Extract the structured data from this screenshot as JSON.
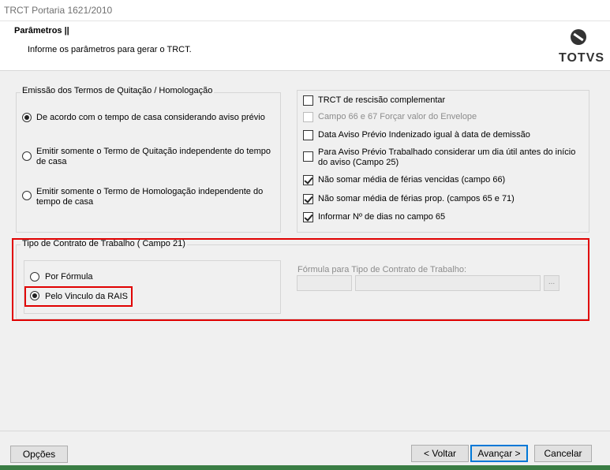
{
  "window": {
    "title": "TRCT Portaria 1621/2010"
  },
  "header": {
    "title": "Parâmetros ||",
    "subtitle": "Informe os parâmetros para gerar o TRCT.",
    "logo_text": "TOTVS"
  },
  "emissao": {
    "legend": "Emissão dos Termos de Quitação / Homologação",
    "options": [
      {
        "label": "De acordo com o tempo de casa considerando aviso prévio",
        "selected": true
      },
      {
        "label": "Emitir somente o Termo de Quitação independente do tempo de casa",
        "selected": false
      },
      {
        "label": "Emitir somente o Termo de Homologação independente do tempo de casa",
        "selected": false
      }
    ]
  },
  "checkboxes": [
    {
      "label": "TRCT de rescisão complementar",
      "checked": false,
      "disabled": false
    },
    {
      "label": "Campo 66 e 67 Forçar valor do Envelope",
      "checked": false,
      "disabled": true
    },
    {
      "label": "Data Aviso Prévio Indenizado igual à data de demissão",
      "checked": false,
      "disabled": false
    },
    {
      "label": "Para Aviso Prévio Trabalhado considerar um dia útil antes do início do aviso (Campo 25)",
      "checked": false,
      "disabled": false
    },
    {
      "label": "Não somar média de férias vencidas (campo 66)",
      "checked": true,
      "disabled": false
    },
    {
      "label": "Não somar média de férias prop. (campos 65 e 71)",
      "checked": true,
      "disabled": false
    },
    {
      "label": "Informar Nº de dias no campo 65",
      "checked": true,
      "disabled": false
    }
  ],
  "contrato": {
    "legend": "Tipo de Contrato de Trabalho ( Campo 21)",
    "options": [
      {
        "label": "Por Fórmula",
        "selected": false
      },
      {
        "label": "Pelo Vinculo da RAIS",
        "selected": true
      }
    ],
    "formula_label": "Fórmula para Tipo de Contrato de Trabalho:",
    "code_value": "",
    "desc_value": "",
    "lookup_label": "..."
  },
  "footer": {
    "options": "Opções",
    "back": "< Voltar",
    "next": "Avançar >",
    "cancel": "Cancelar"
  },
  "colors": {
    "highlight": "#e00000",
    "accent": "#0078d7"
  }
}
